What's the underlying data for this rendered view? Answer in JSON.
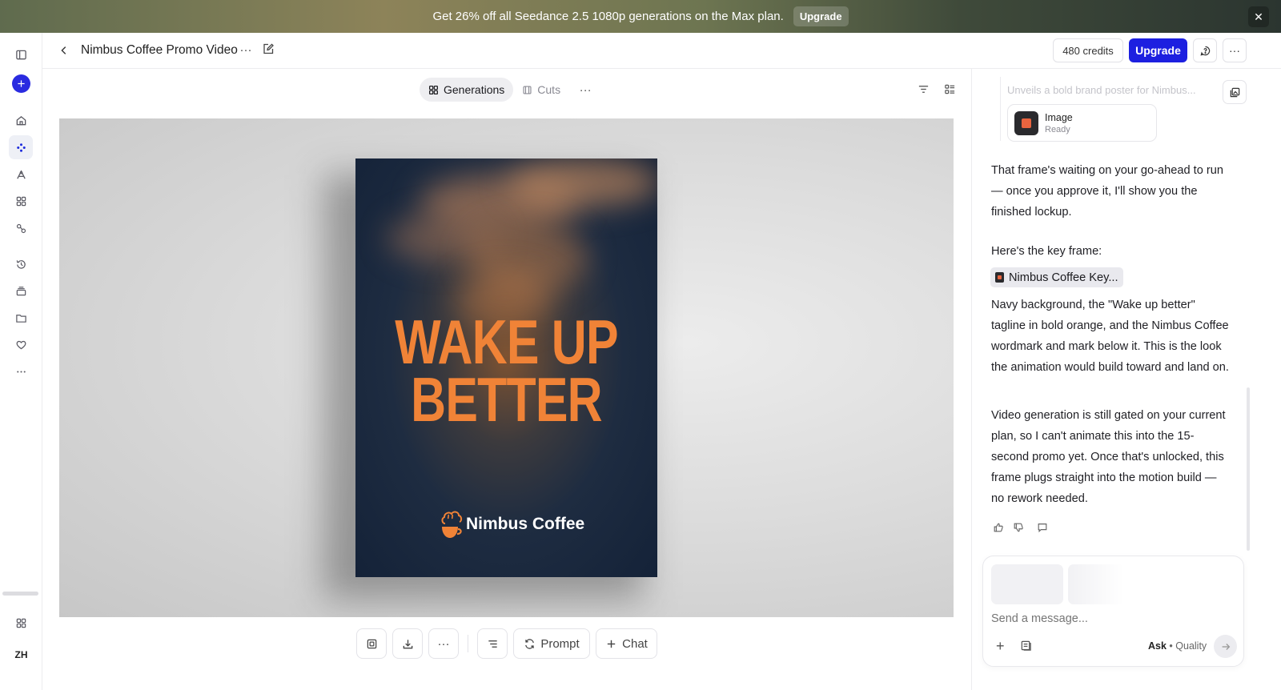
{
  "banner": {
    "text": "Get 26% off all Seedance 2.5 1080p generations on the Max plan.",
    "upgrade_label": "Upgrade",
    "close_icon": "close-icon"
  },
  "rail": {
    "icons": [
      "sidebar-toggle-icon",
      "plus-icon",
      "home-icon",
      "create-icon",
      "draw-icon",
      "apps-icon",
      "nodes-icon",
      "history-icon",
      "stack-icon",
      "folder-icon",
      "heart-icon",
      "more-icon",
      "grid-icon"
    ],
    "language_label": "ZH"
  },
  "header": {
    "back_icon": "chevron-left-icon",
    "title": "Nimbus Coffee Promo Video",
    "more_label": "···",
    "credits_label": "480 credits",
    "upgrade_label": "Upgrade",
    "overflow_label": "···"
  },
  "tabs": [
    {
      "label": "Generations",
      "icon": "grid-icon",
      "active": true
    },
    {
      "label": "Cuts",
      "icon": "film-icon",
      "active": false
    }
  ],
  "tabs_more_label": "···",
  "poster": {
    "headline_line1": "WAKE UP",
    "headline_line2": "BETTER",
    "brand_name": "Nimbus Coffee",
    "colors": {
      "navy": "#142238",
      "orange": "#f08337"
    }
  },
  "toolbar": {
    "more_label": "···",
    "prompt_label": "Prompt",
    "chat_label": "Chat"
  },
  "chat": {
    "faded_text": "Unveils a bold brand poster for Nimbus...",
    "card_title": "Image",
    "card_status": "Ready",
    "message1": "That frame's waiting on your go-ahead to run — once you approve it, I'll show you the finished lockup.",
    "message2": "Here's the key frame:",
    "chip_label": "Nimbus Coffee Key...",
    "message3": "Navy background, the \"Wake up better\" tagline in bold orange, and the Nimbus Coffee wordmark and mark below it. This is the look the animation would build toward and land on.",
    "message4": "Video generation is still gated on your current plan, so I can't animate this into the 15-second promo yet. Once that's unlocked, this frame plugs straight into the motion build — no rework needed."
  },
  "composer": {
    "placeholder": "Send a message...",
    "mode_label": "Ask",
    "separator": " • ",
    "quality_label": "Quality"
  },
  "accent_color": "#1d20e0"
}
